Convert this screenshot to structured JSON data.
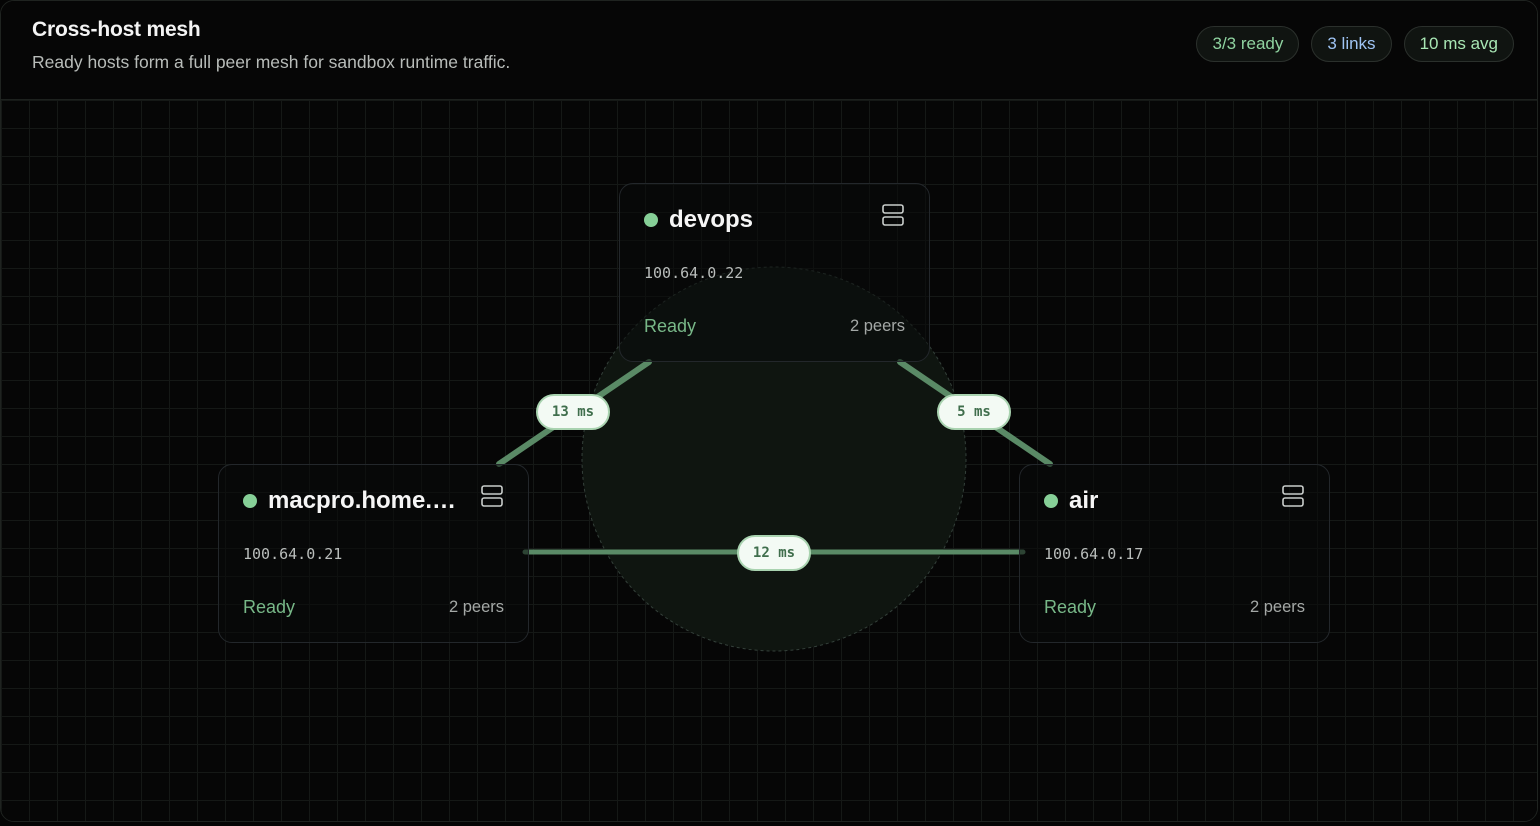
{
  "header": {
    "title": "Cross-host mesh",
    "subtitle": "Ready hosts form a full peer mesh for sandbox runtime traffic."
  },
  "badges": [
    {
      "label": "3/3 ready",
      "color": "#8fd3a0"
    },
    {
      "label": "3 links",
      "color": "#9fc4f4"
    },
    {
      "label": "10 ms avg",
      "color": "#a8e6b4"
    }
  ],
  "nodes": [
    {
      "name": "devops",
      "ip": "100.64.0.22",
      "status": "Ready",
      "peers": "2 peers",
      "icon": "server-icon"
    },
    {
      "name": "macpro.home.…",
      "ip": "100.64.0.21",
      "status": "Ready",
      "peers": "2 peers",
      "icon": "server-icon"
    },
    {
      "name": "air",
      "ip": "100.64.0.17",
      "status": "Ready",
      "peers": "2 peers",
      "icon": "server-icon"
    }
  ],
  "links": [
    {
      "from": "macpro.home.…",
      "to": "devops",
      "latency": "13 ms"
    },
    {
      "from": "devops",
      "to": "air",
      "latency": "5 ms"
    },
    {
      "from": "macpro.home.…",
      "to": "air",
      "latency": "12 ms"
    }
  ],
  "colors": {
    "link": "#5a8a66",
    "ready": "#78b888",
    "status_dot": "#86cf97"
  }
}
